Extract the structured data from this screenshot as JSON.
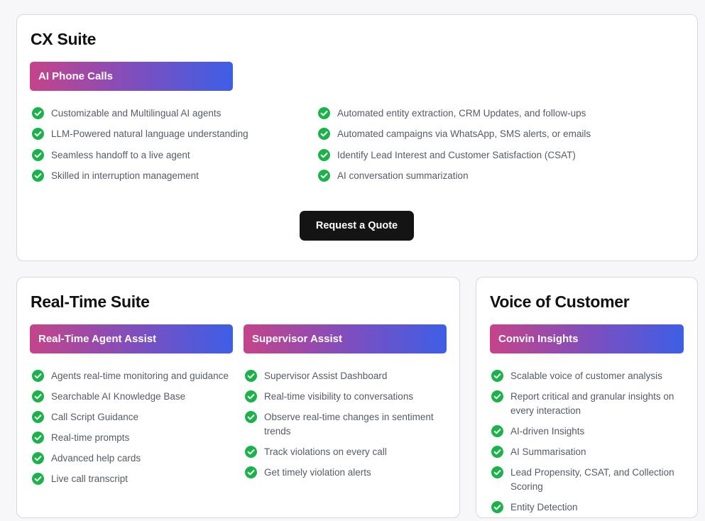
{
  "cx_suite": {
    "title": "CX Suite",
    "pill": "AI Phone Calls",
    "left_features": [
      "Customizable and Multilingual AI agents",
      "LLM-Powered natural language understanding",
      "Seamless handoff to a live agent",
      "Skilled in interruption management"
    ],
    "right_features": [
      "Automated entity extraction, CRM Updates, and follow-ups",
      "Automated campaigns via WhatsApp, SMS alerts, or emails",
      "Identify Lead Interest and Customer Satisfaction (CSAT)",
      "AI conversation summarization"
    ],
    "cta_label": "Request a Quote"
  },
  "realtime_suite": {
    "title": "Real-Time Suite",
    "agent_assist": {
      "pill": "Real-Time Agent Assist",
      "features": [
        "Agents real-time monitoring and guidance",
        "Searchable AI Knowledge Base",
        "Call Script Guidance",
        "Real-time prompts",
        "Advanced help cards",
        "Live call transcript"
      ]
    },
    "supervisor_assist": {
      "pill": "Supervisor Assist",
      "features": [
        "Supervisor Assist Dashboard",
        "Real-time visibility to conversations",
        "Observe real-time changes in sentiment trends",
        "Track violations on every call",
        "Get timely violation alerts"
      ]
    }
  },
  "voice_of_customer": {
    "title": "Voice of Customer",
    "pill": "Convin Insights",
    "features": [
      "Scalable voice of customer analysis",
      "Report critical and granular insights on every interaction",
      "AI-driven Insights",
      "AI Summarisation",
      "Lead Propensity, CSAT, and Collection Scoring",
      "Entity Detection"
    ]
  },
  "colors": {
    "check_green": "#19b34a",
    "gradient_start": "#c5448a",
    "gradient_end": "#3d5fe6",
    "cta_bg": "#141414"
  },
  "icons": {
    "feature_bullet": "check-circle-icon"
  }
}
